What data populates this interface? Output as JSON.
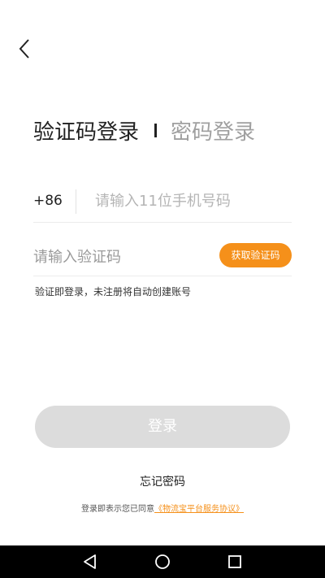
{
  "tabs": {
    "active_label": "验证码登录",
    "inactive_label": "密码登录"
  },
  "phone": {
    "country_code": "+86",
    "placeholder": "请输入11位手机号码",
    "value": ""
  },
  "code": {
    "placeholder": "请输入验证码",
    "value": "",
    "get_code_label": "获取验证码"
  },
  "hint": "验证即登录，未注册将自动创建账号",
  "login_label": "登录",
  "forgot_label": "忘记密码",
  "agreement": {
    "prefix": "登录即表示您已同意",
    "link_label": "《物流宝平台服务协议》"
  },
  "icons": {
    "back": "chevron-left-icon",
    "nav_back": "triangle-back-icon",
    "nav_home": "circle-home-icon",
    "nav_recents": "square-recents-icon"
  },
  "colors": {
    "accent": "#f5901a",
    "disabled_button": "#dcdcdc",
    "text_primary": "#222222",
    "text_muted": "#a0a0a0"
  }
}
